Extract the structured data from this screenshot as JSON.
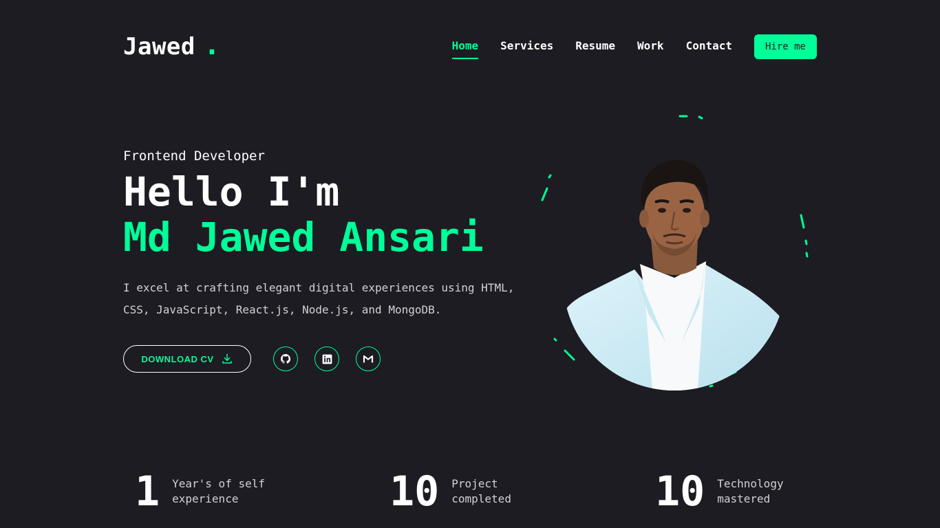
{
  "brand": {
    "name": "Jawed",
    "dot": "."
  },
  "nav": {
    "items": [
      {
        "label": "Home",
        "active": true
      },
      {
        "label": "Services",
        "active": false
      },
      {
        "label": "Resume",
        "active": false
      },
      {
        "label": "Work",
        "active": false
      },
      {
        "label": "Contact",
        "active": false
      }
    ],
    "cta": "Hire me"
  },
  "hero": {
    "role": "Frontend Developer",
    "greeting": "Hello I'm",
    "name": "Md Jawed Ansari",
    "description_lines": [
      "I excel at crafting elegant digital experiences using HTML,",
      "CSS, JavaScript, React.js, Node.js, and MongoDB."
    ],
    "download_label": "DOWNLOAD CV",
    "socials": [
      {
        "icon": "github-icon"
      },
      {
        "icon": "linkedin-icon"
      },
      {
        "icon": "gmail-icon"
      }
    ]
  },
  "stats": [
    {
      "number": "1",
      "label_lines": [
        "Year's of self",
        "experience"
      ]
    },
    {
      "number": "10",
      "label_lines": [
        "Project",
        "completed"
      ]
    },
    {
      "number": "10",
      "label_lines": [
        "Technology",
        "mastered"
      ]
    }
  ],
  "colors": {
    "accent": "#00ff99",
    "background": "#1c1c22",
    "text": "#ffffff"
  }
}
